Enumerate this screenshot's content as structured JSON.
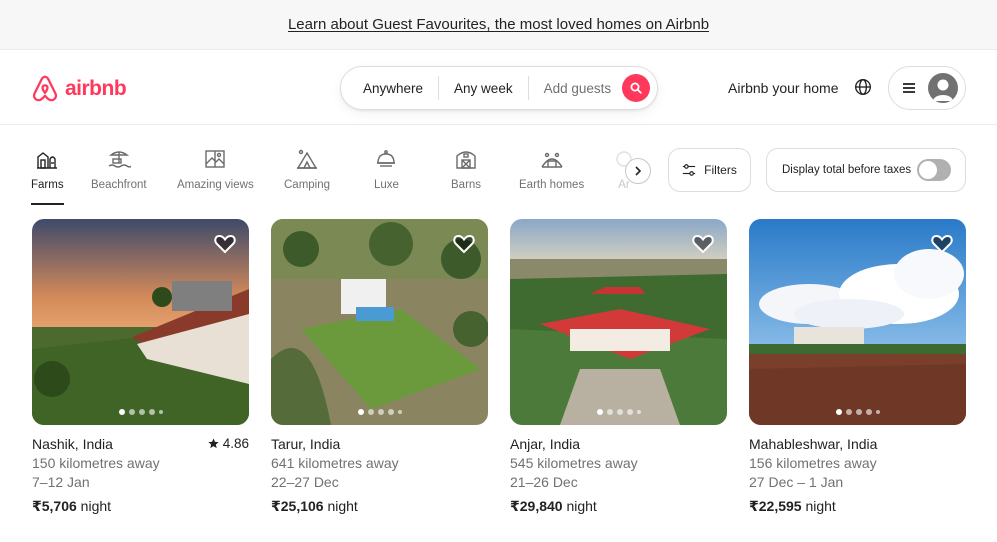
{
  "banner": {
    "text": "Learn about Guest Favourites, the most loved homes on Airbnb"
  },
  "header": {
    "logo_text": "airbnb",
    "search": {
      "where": "Anywhere",
      "when": "Any week",
      "guests": "Add guests"
    },
    "host_link": "Airbnb your home"
  },
  "categories": {
    "items": [
      {
        "label": "Farms",
        "icon": "farm-icon",
        "active": true
      },
      {
        "label": "Beachfront",
        "icon": "beachfront-icon"
      },
      {
        "label": "Amazing views",
        "icon": "amazing-views-icon"
      },
      {
        "label": "Camping",
        "icon": "camping-icon"
      },
      {
        "label": "Luxe",
        "icon": "luxe-icon"
      },
      {
        "label": "Barns",
        "icon": "barn-icon"
      },
      {
        "label": "Earth homes",
        "icon": "earth-homes-icon"
      },
      {
        "label": "Ar",
        "icon": "partial-category-icon"
      }
    ],
    "filters_label": "Filters",
    "tax_toggle_label": "Display total before taxes"
  },
  "listings": [
    {
      "location": "Nashik, India",
      "rating": "4.86",
      "distance": "150 kilometres away",
      "dates": "7–12 Jan",
      "price": "₹5,706",
      "price_unit": "night"
    },
    {
      "location": "Tarur, India",
      "rating": "",
      "distance": "641 kilometres away",
      "dates": "22–27 Dec",
      "price": "₹25,106",
      "price_unit": "night"
    },
    {
      "location": "Anjar, India",
      "rating": "",
      "distance": "545 kilometres away",
      "dates": "21–26 Dec",
      "price": "₹29,840",
      "price_unit": "night"
    },
    {
      "location": "Mahableshwar, India",
      "rating": "",
      "distance": "156 kilometres away",
      "dates": "27 Dec – 1 Jan",
      "price": "₹22,595",
      "price_unit": "night"
    }
  ],
  "colors": {
    "brand": "#ff385c",
    "text": "#222222",
    "muted": "#717171",
    "border": "#dddddd"
  }
}
